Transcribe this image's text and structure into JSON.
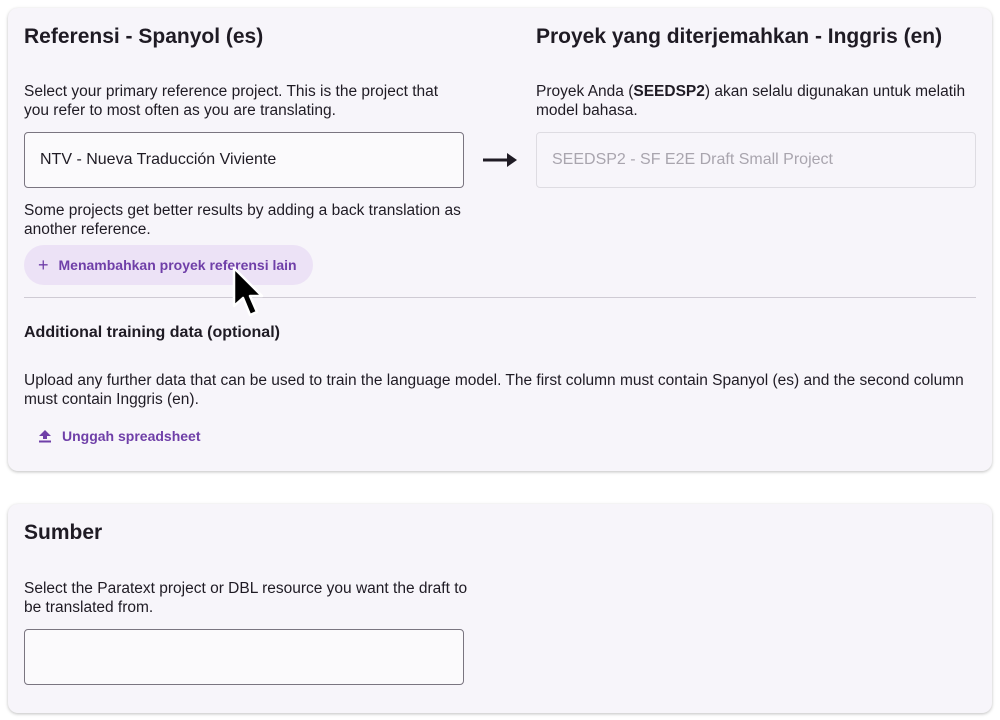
{
  "reference": {
    "title": "Referensi - Spanyol (es)",
    "description": "Select your primary reference project. This is the project that you refer to most often as you are translating.",
    "selected_project": "NTV - Nueva Traducción Viviente",
    "back_translation_hint": "Some projects get better results by adding a back translation as another reference.",
    "add_reference_label": "Menambahkan proyek referensi lain",
    "add_reference_icon": "plus-icon"
  },
  "target": {
    "title": "Proyek yang diterjemahkan - Inggris (en)",
    "desc_prefix": "Proyek Anda (",
    "desc_code": "SEEDSP2",
    "desc_suffix": ") akan selalu digunakan untuk melatih model bahasa.",
    "project_value": "SEEDSP2 - SF E2E Draft Small Project",
    "arrow_icon": "arrow-right-icon"
  },
  "training": {
    "title": "Additional training data (optional)",
    "description": "Upload any further data that can be used to train the language model. The first column must contain Spanyol (es) and the second column must contain Inggris (en).",
    "upload_label": "Unggah spreadsheet",
    "upload_icon": "upload-icon"
  },
  "source": {
    "title": "Sumber",
    "description": "Select the Paratext project or DBL resource you want the draft to be translated from.",
    "input_value": ""
  },
  "colors": {
    "accent": "#6f3fa8",
    "pill_bg": "#ece2f6",
    "card_bg": "#f7f5fa"
  }
}
